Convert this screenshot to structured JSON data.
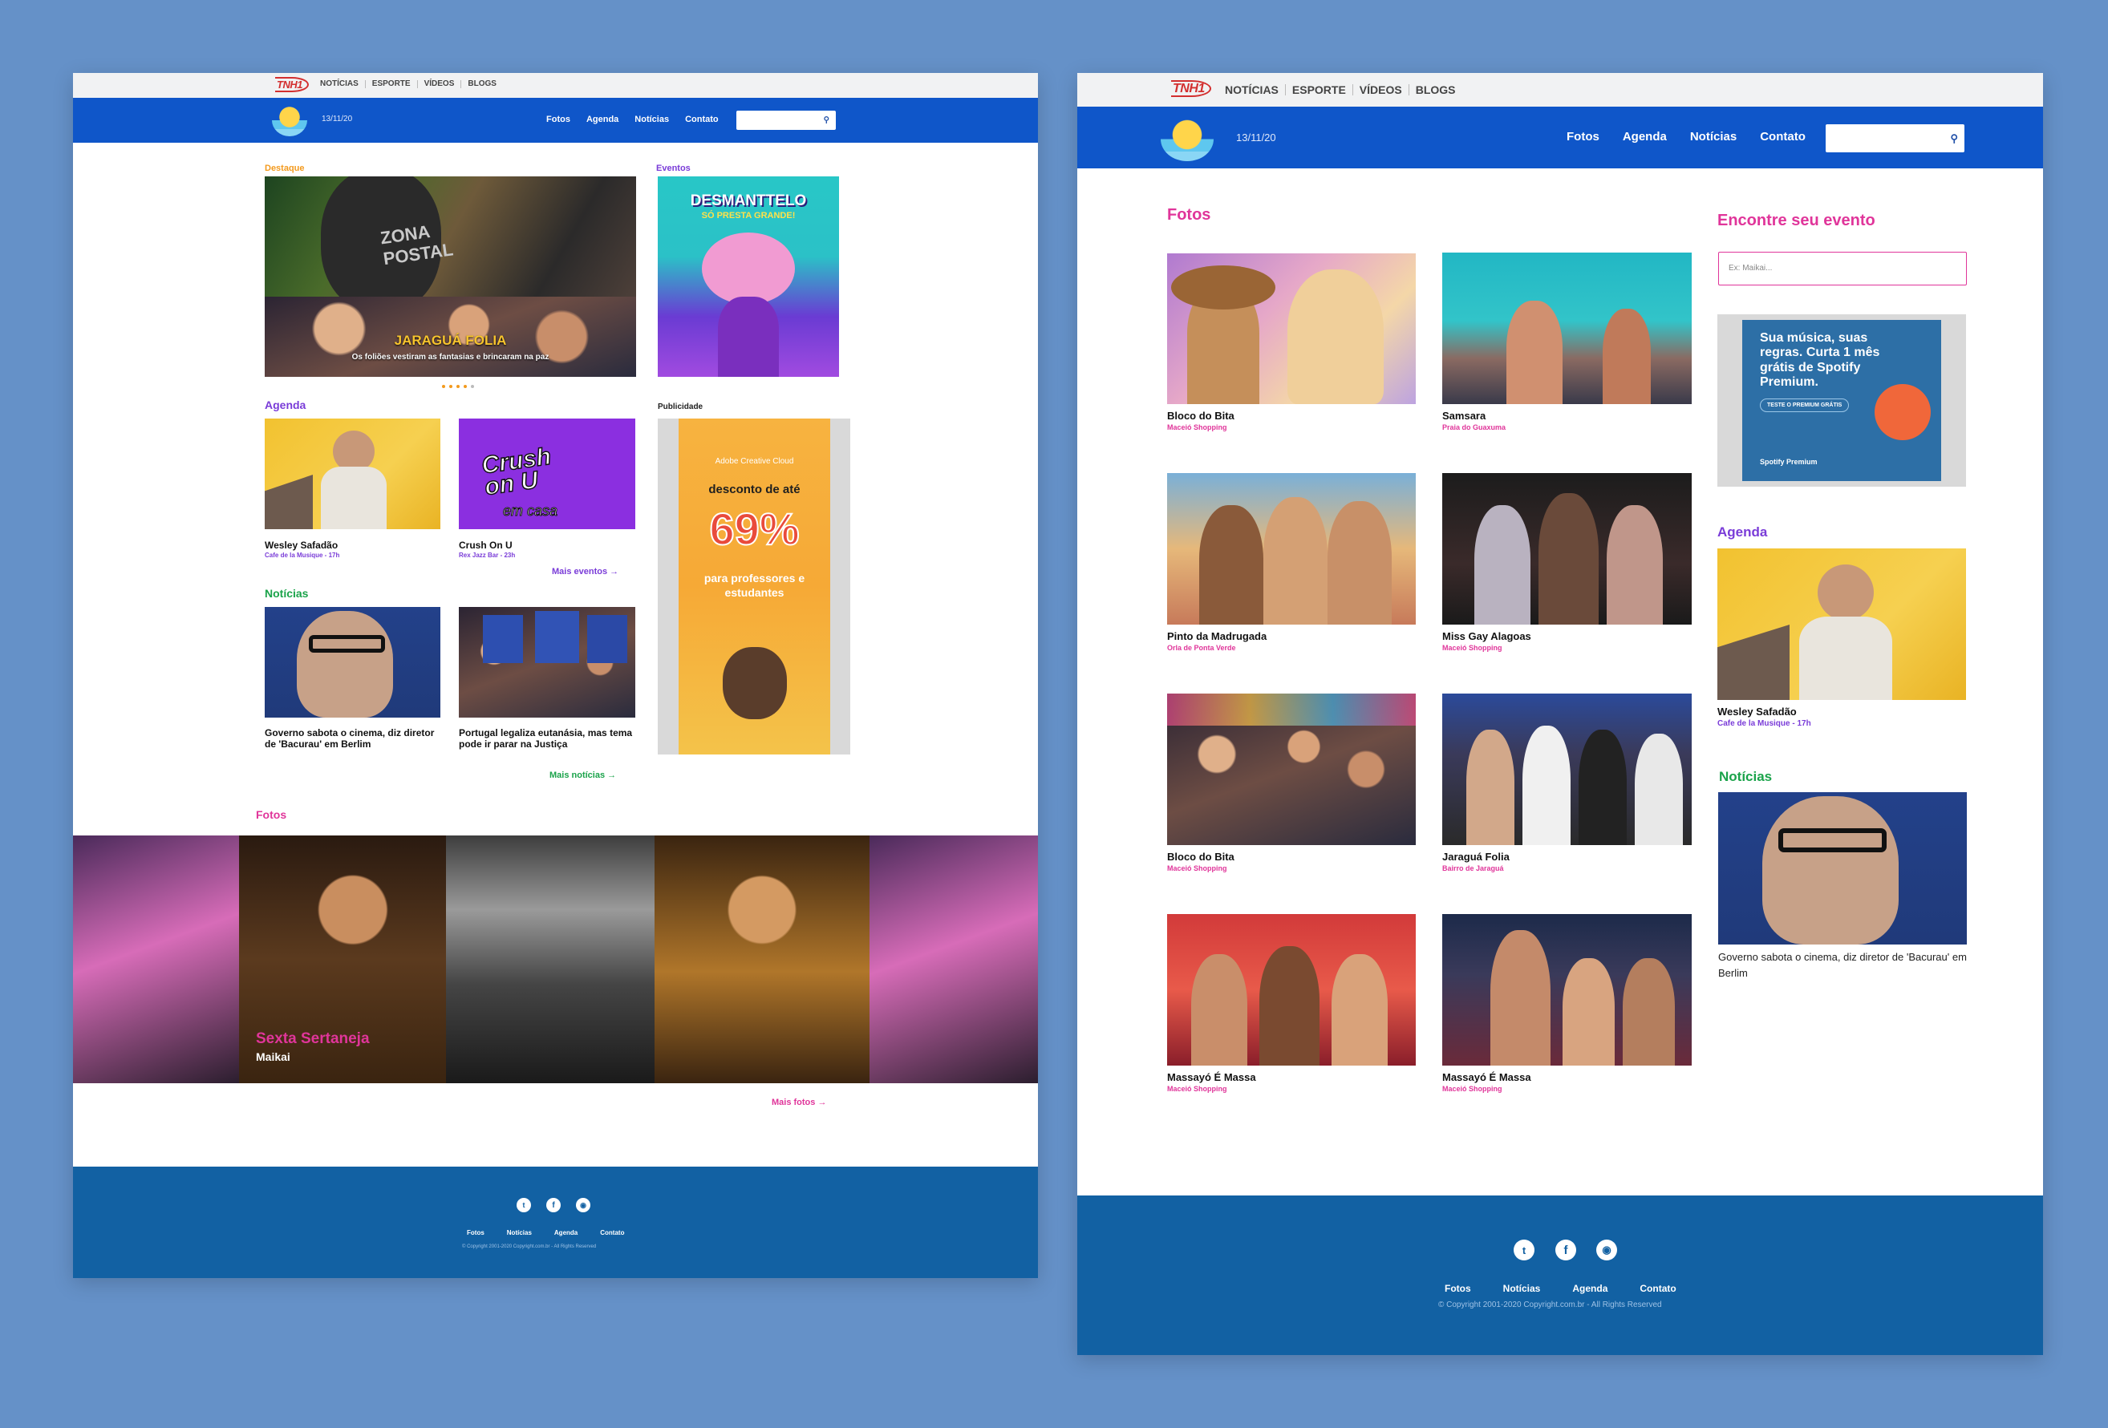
{
  "left": {
    "topbar": {
      "brand": "TNH1",
      "links": [
        "NOTÍCIAS",
        "ESPORTE",
        "VÍDEOS",
        "BLOGS"
      ]
    },
    "nav": {
      "date": "13/11/20",
      "links": [
        "Fotos",
        "Agenda",
        "Notícias",
        "Contato"
      ],
      "search_placeholder": "",
      "search_icon": "search-icon"
    },
    "destaque": {
      "label": "Destaque",
      "title": "JARAGUÁ FOLIA",
      "subtitle": "Os foliões vestiram as fantasias e brincaram na paz",
      "carousel_count": 5
    },
    "eventos": {
      "label": "Eventos",
      "poster_title": "DESMANTTELO",
      "poster_sub": "SÓ PRESTA GRANDE!"
    },
    "agenda": {
      "label": "Agenda",
      "items": [
        {
          "title": "Wesley Safadão",
          "sub": "Cafe de la Musique - 17h"
        },
        {
          "title": "Crush On U",
          "sub": "Rex Jazz Bar - 23h"
        }
      ],
      "more": "Mais eventos"
    },
    "publicidade": {
      "label": "Publicidade",
      "ad_brand": "Adobe Creative Cloud",
      "ad_line1": "desconto de até",
      "ad_percent": "69%",
      "ad_line2": "para professores e estudantes"
    },
    "noticias": {
      "label": "Notícias",
      "items": [
        {
          "title": "Governo sabota o cinema, diz diretor de 'Bacurau' em Berlim"
        },
        {
          "title": "Portugal legaliza eutanásia, mas tema pode ir parar na Justiça"
        }
      ],
      "more": "Mais notícias"
    },
    "fotos": {
      "label": "Fotos",
      "feature_title": "Sexta Sertaneja",
      "feature_sub": "Maikai",
      "more": "Mais fotos"
    },
    "footer": {
      "links": [
        "Fotos",
        "Notícias",
        "Agenda",
        "Contato"
      ],
      "copyright": "© Copyright 2001-2020 Copyright.com.br - All Rights Reserved",
      "social": [
        "twitter-icon",
        "facebook-icon",
        "instagram-icon"
      ]
    }
  },
  "right": {
    "topbar": {
      "brand": "TNH1",
      "links": [
        "NOTÍCIAS",
        "ESPORTE",
        "VÍDEOS",
        "BLOGS"
      ]
    },
    "nav": {
      "date": "13/11/20",
      "links": [
        "Fotos",
        "Agenda",
        "Notícias",
        "Contato"
      ],
      "search_placeholder": ""
    },
    "fotos": {
      "label": "Fotos",
      "items": [
        {
          "title": "Bloco do Bita",
          "sub": "Maceió Shopping"
        },
        {
          "title": "Samsara",
          "sub": "Praia do Guaxuma"
        },
        {
          "title": "Pinto da Madrugada",
          "sub": "Orla de Ponta Verde"
        },
        {
          "title": "Miss Gay Alagoas",
          "sub": "Maceió Shopping"
        },
        {
          "title": "Bloco do Bita",
          "sub": "Maceió Shopping"
        },
        {
          "title": "Jaraguá Folia",
          "sub": "Bairro de Jaraguá"
        },
        {
          "title": "Massayó É Massa",
          "sub": "Maceió Shopping"
        },
        {
          "title": "Massayó É Massa",
          "sub": "Maceió Shopping"
        }
      ]
    },
    "sidebar": {
      "find_label": "Encontre seu evento",
      "find_placeholder": "Ex: Maikai...",
      "ad_text": "Sua música, suas regras. Curta 1 mês grátis de Spotify Premium.",
      "ad_button": "TESTE O PREMIUM GRÁTIS",
      "ad_brand": "Spotify Premium",
      "agenda_label": "Agenda",
      "agenda_title": "Wesley Safadão",
      "agenda_sub": "Cafe de la Musique - 17h",
      "noticias_label": "Notícias",
      "noticias_title": "Governo sabota o cinema, diz diretor de 'Bacurau' em Berlim"
    },
    "footer": {
      "links": [
        "Fotos",
        "Notícias",
        "Agenda",
        "Contato"
      ],
      "copyright": "© Copyright 2001-2020 Copyright.com.br - All Rights Reserved"
    }
  },
  "colors": {
    "nav_blue": "#0f56c9",
    "footer_blue": "#1261a3",
    "pink": "#e0359a",
    "purple": "#7a3cd8",
    "green": "#1aa34a",
    "orange": "#f39a1e",
    "page_bg": "#6591c8"
  }
}
